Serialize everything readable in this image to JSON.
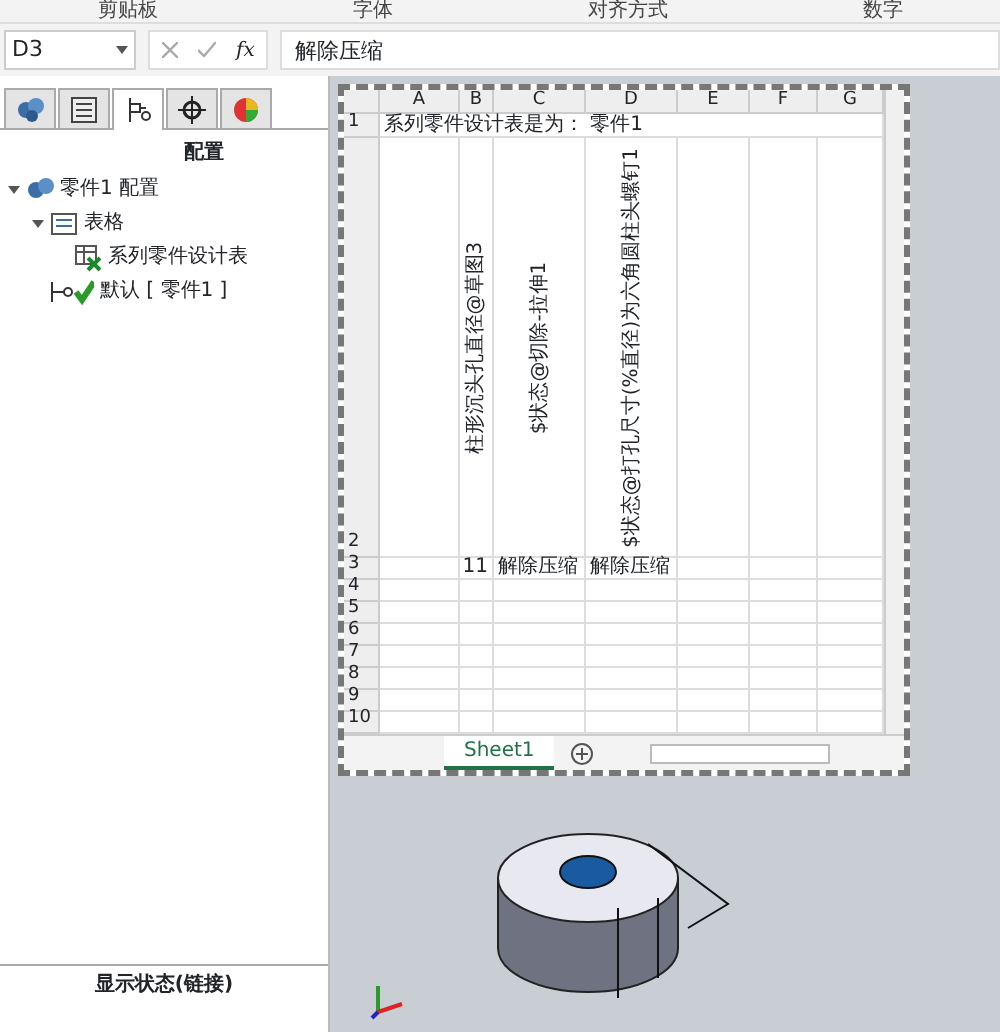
{
  "ribbon": {
    "groups": [
      "剪贴板",
      "字体",
      "对齐方式",
      "数字"
    ]
  },
  "formula_bar": {
    "name_box": "D3",
    "function_label": "fx",
    "value": "解除压缩"
  },
  "panel": {
    "tabs": [
      {
        "kind": "part",
        "selected": false
      },
      {
        "kind": "list",
        "selected": false
      },
      {
        "kind": "config",
        "selected": true
      },
      {
        "kind": "target",
        "selected": false
      },
      {
        "kind": "appearance",
        "selected": false
      }
    ],
    "title": "配置",
    "tree": [
      {
        "label": "零件1 配置",
        "kind": "configs",
        "expanded": true,
        "children": [
          {
            "label": "表格",
            "kind": "folder",
            "expanded": true,
            "children": [
              {
                "label": "系列零件设计表",
                "kind": "table"
              }
            ]
          },
          {
            "label": "默认 [ 零件1 ]",
            "kind": "config"
          }
        ]
      }
    ],
    "display_state": {
      "title": "显示状态(链接)"
    }
  },
  "sheet": {
    "columns": [
      "A",
      "B",
      "C",
      "D",
      "E",
      "F",
      "G"
    ],
    "rows": [
      {
        "number": "1",
        "cells": [
          "系列零件设计表是为： 零件1"
        ]
      },
      {
        "number": "2",
        "rotated": true,
        "cells": [
          "",
          "柱形沉头孔直径@草图3",
          "$状态@切除-拉伸1",
          "$状态@打孔尺寸(%直径)为六角圆柱头螺钉1"
        ]
      },
      {
        "number": "3",
        "cells": [
          "",
          "11",
          "解除压缩",
          "解除压缩"
        ]
      },
      {
        "number": "4",
        "cells": []
      },
      {
        "number": "5",
        "cells": []
      },
      {
        "number": "6",
        "cells": []
      },
      {
        "number": "7",
        "cells": []
      },
      {
        "number": "8",
        "cells": []
      },
      {
        "number": "9",
        "cells": []
      },
      {
        "number": "10",
        "cells": []
      }
    ],
    "tabs": [
      {
        "label": "Sheet1",
        "selected": true
      }
    ]
  }
}
